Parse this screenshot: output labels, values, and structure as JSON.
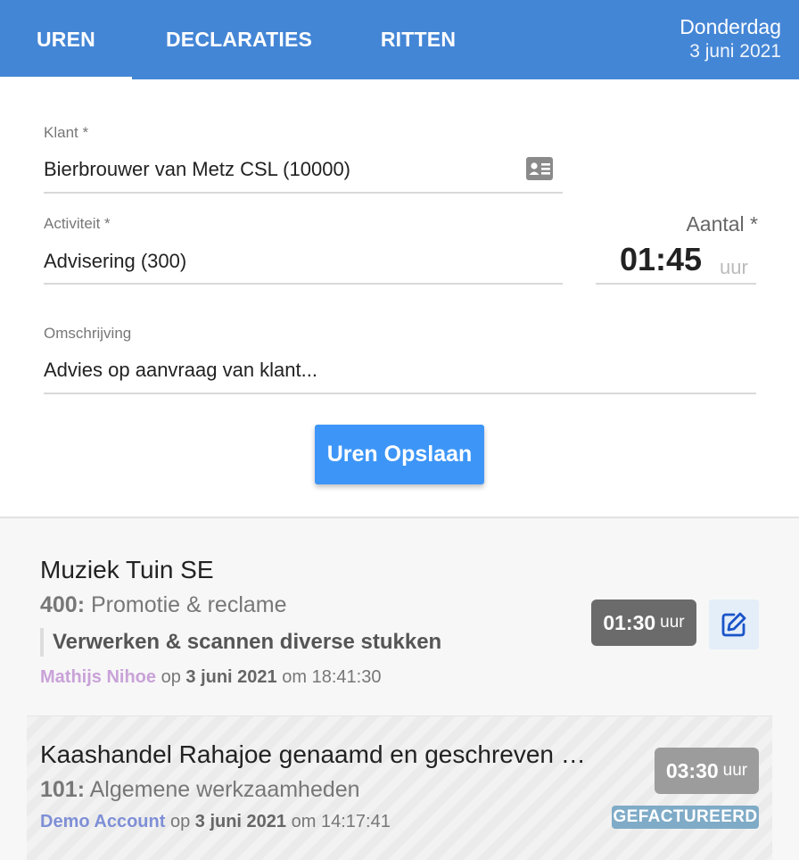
{
  "header": {
    "tabs": [
      {
        "label": "UREN",
        "active": true
      },
      {
        "label": "DECLARATIES",
        "active": false
      },
      {
        "label": "RITTEN",
        "active": false
      }
    ],
    "day": "Donderdag",
    "date": "3 juni 2021"
  },
  "form": {
    "klant": {
      "label": "Klant *",
      "value": "Bierbrouwer van Metz CSL (10000)",
      "icon": "contact-card-icon"
    },
    "activiteit": {
      "label": "Activiteit *",
      "value": "Advisering (300)"
    },
    "aantal": {
      "label": "Aantal *",
      "value": "01:45",
      "unit": "uur"
    },
    "omschrijving": {
      "label": "Omschrijving",
      "value": "Advies op aanvraag van klant..."
    },
    "save_label": "Uren Opslaan"
  },
  "entries": [
    {
      "client": "Muziek Tuin SE",
      "activity_code": "400:",
      "activity_name": "Promotie & reclame",
      "description": "Verwerken & scannen diverse stukken",
      "user": "Mathijs Nihoe",
      "op": "op",
      "date": "3 juni 2021",
      "om": "om",
      "time": "18:41:30",
      "hours": "01:30",
      "unit": "uur",
      "edit_icon": "edit-icon"
    },
    {
      "client": "Kaashandel Rahajoe genaamd en geschreven …",
      "activity_code": "101:",
      "activity_name": "Algemene werkzaamheden",
      "user": "Demo Account",
      "op": "op",
      "date": "3 juni 2021",
      "om": "om",
      "time": "14:17:41",
      "hours": "03:30",
      "unit": "uur",
      "status": "GEFACTUREERD"
    }
  ],
  "colors": {
    "header": "#4486d6",
    "button": "#3d96f7",
    "status": "#7fabc7"
  }
}
